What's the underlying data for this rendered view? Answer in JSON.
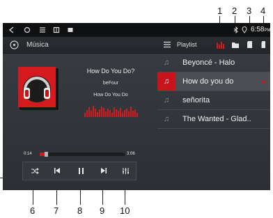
{
  "callouts": [
    "1",
    "2",
    "3",
    "4",
    "6",
    "7",
    "8",
    "9",
    "10"
  ],
  "statusbar": {
    "time": "6:58",
    "ampm": "PM"
  },
  "header": {
    "app_title": "Música",
    "playlist_label": "Playlist"
  },
  "now_playing": {
    "title": "How Do You Do?",
    "artist": "beFour",
    "album": "How Do You Do",
    "elapsed": "0:14",
    "duration": "3:06",
    "progress_fraction": 0.07
  },
  "playlist": {
    "items": [
      {
        "label": "Beyoncé - Halo"
      },
      {
        "label": "How do you do"
      },
      {
        "label": "señorita"
      },
      {
        "label": "The Wanted - Glad.."
      }
    ],
    "active_index": 1
  },
  "colors": {
    "accent": "#c8141c",
    "screen_bg": "#2f3236",
    "statusbar_bg": "#0f1012"
  },
  "icons": {
    "statusbar": [
      "back-icon",
      "home-icon",
      "menu-icon",
      "recent-apps-icon",
      "screenshot-icon",
      "bluetooth-icon",
      "location-icon"
    ],
    "header": [
      "music-disc-icon",
      "list-menu-icon",
      "equalizer-icon",
      "folder-icon",
      "sd-card-icon",
      "usb-icon"
    ],
    "controls": [
      "shuffle-icon",
      "previous-icon",
      "pause-icon",
      "next-icon",
      "equalizer-sliders-icon"
    ]
  }
}
